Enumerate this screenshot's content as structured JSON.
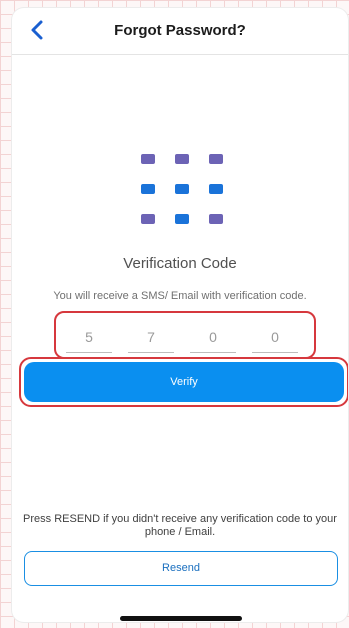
{
  "header": {
    "title": "Forgot Password?"
  },
  "verification": {
    "title": "Verification Code",
    "subtitle": "You will receive a SMS/ Email with verification code.",
    "digits": [
      "5",
      "7",
      "0",
      "0"
    ]
  },
  "actions": {
    "verify_label": "Verify",
    "resend_note": "Press RESEND if you didn't receive any verification code to your phone / Email.",
    "resend_label": "Resend"
  },
  "icons": {
    "back": "chevron-left-icon",
    "keypad": "keypad-grid-icon"
  },
  "colors": {
    "accent": "#0a8ff0",
    "highlight": "#d6383d",
    "keypad_purple": "#6c63b5",
    "keypad_blue": "#1a73d9"
  }
}
